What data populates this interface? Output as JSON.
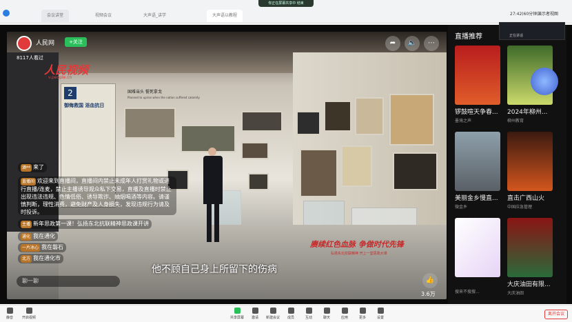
{
  "browser": {
    "tabs": [
      "会议讲堂",
      "视频会议",
      "大声语_讲学",
      "大声语以教程"
    ],
    "share_notice": "你正在屏幕共享中 结束",
    "time_label": "27:42(60分钟)",
    "view_label": "演示者视图"
  },
  "stream": {
    "channel_name": "人民网",
    "follow_label": "+关注",
    "watching": "8117人看过",
    "watermark": "人民视频",
    "watermark_url": "v.people.cn",
    "subtitle": "他不顾自己身上所留下的伤病",
    "slogan_line1": "赓续红色血脉 争做时代先锋",
    "slogan_line2": "弘扬东北抗联精神 开上一堂思政大课",
    "likes": "3.6万",
    "comment_placeholder": "聊一聊"
  },
  "exhibit": {
    "banner_num": "2",
    "banner_title": "御侮救国 浴血抗日",
    "wall_title": "国难当头 誓死拿戈",
    "wall_sub": "Planned to uprise when the nation suffered calamity"
  },
  "chat": [
    {
      "user": "酒**",
      "text": "来了"
    },
    {
      "user": "直播间",
      "text": "欢迎来到直播间，直播间内禁止未成年人打赏礼物或进行直播/连麦，禁止主播诱导观众私下交易，直播及直播时禁止出现违法违规、色情低俗、诱导欺诈、抽烟喝酒等内容。请谨慎判断，理性消费，避免财产及人身损失，发现违规行为请及时投诉。"
    },
    {
      "user": "主播",
      "text": "新年思政第一课！弘扬东北抗联精神思政课开讲"
    },
    {
      "user": "通化",
      "text": "我在通化"
    },
    {
      "user": "一片冰心",
      "text": "我在磐石"
    },
    {
      "user": "北方",
      "text": "我在通化市"
    }
  ],
  "recommend": {
    "title": "直播推荐",
    "items": [
      {
        "title": "锣鼓喧天争春...",
        "author": "墨境之声"
      },
      {
        "title": "2024年柳州...",
        "author": "柳州教育"
      },
      {
        "title": "美丽金乡慢直...",
        "author": "微金乡"
      },
      {
        "title": "直击广西山火",
        "author": "中国应急管理"
      },
      {
        "title": "",
        "author": "搜来不搜搜..."
      },
      {
        "title": "大庆油田有限...",
        "author": "大庆油田"
      }
    ]
  },
  "participant_panel": {
    "label": "正在讲话"
  },
  "toolbar": {
    "items": [
      "共享屏幕",
      "邀请",
      "新建会议",
      "成员",
      "互动",
      "聊天",
      "应用",
      "更多",
      "设置"
    ],
    "left": [
      "静音",
      "开启视频"
    ],
    "end_label": "离开会议"
  },
  "colors": {
    "accent": "#e03a3a",
    "toolbar_bg": "#f7f7f7",
    "follow": "#2bbf5c"
  }
}
